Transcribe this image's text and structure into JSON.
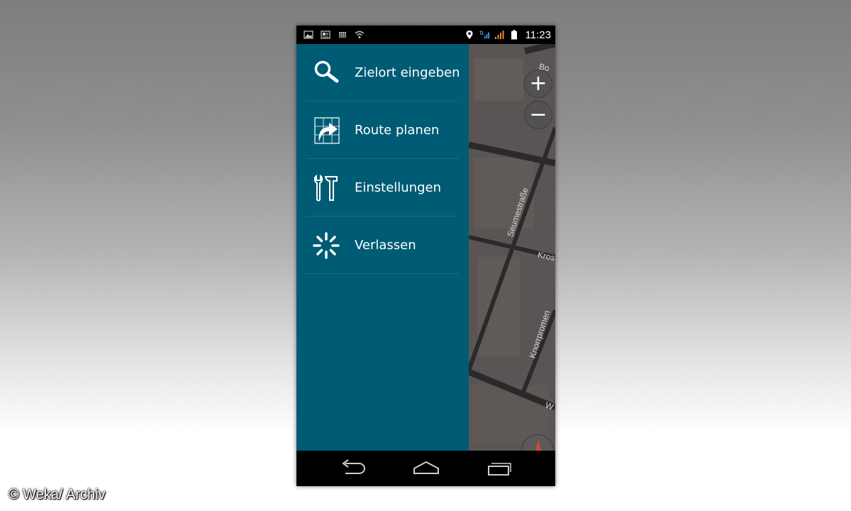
{
  "status_bar": {
    "time": "11:23",
    "left_icons": [
      "gallery-icon",
      "image-icon",
      "grid-icon",
      "wifi-icon"
    ],
    "right_icons": [
      "location-pin-icon",
      "data-signal-icon",
      "cell-signal-icon",
      "battery-icon"
    ]
  },
  "drawer": {
    "background": "#005b75",
    "items": [
      {
        "label": "Zielort eingeben",
        "icon": "search-icon"
      },
      {
        "label": "Route planen",
        "icon": "route-arrow-icon"
      },
      {
        "label": "Einstellungen",
        "icon": "tools-icon"
      },
      {
        "label": "Verlassen",
        "icon": "exit-burst-icon"
      }
    ]
  },
  "map": {
    "zoom_in_label": "+",
    "zoom_out_label": "−",
    "street_labels": [
      "Bo",
      "Seumestraße",
      "Kros",
      "Knorrpromen",
      "W"
    ]
  },
  "nav_bar": {
    "buttons": [
      "back-icon",
      "home-icon",
      "recent-apps-icon"
    ]
  },
  "watermark": "© Weka/ Archiv"
}
